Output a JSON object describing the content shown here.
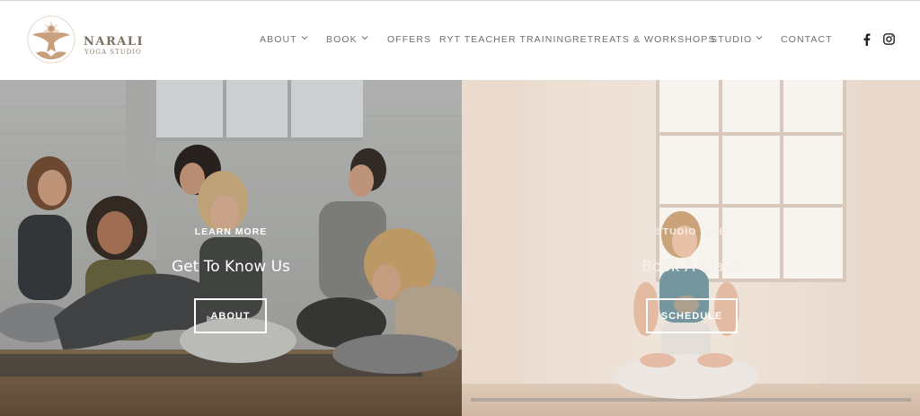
{
  "brand": {
    "name": "NARALI",
    "subtitle": "YOGA STUDIO",
    "logo_icon": "lotus-figure-icon",
    "accent": "#c9a98b"
  },
  "nav": {
    "items": [
      {
        "label": "ABOUT",
        "dropdown": true
      },
      {
        "label": "BOOK",
        "dropdown": true
      },
      {
        "label": "OFFERS",
        "dropdown": false
      },
      {
        "label": "RYT TEACHER TRAINING",
        "dropdown": false
      },
      {
        "label": "RETREATS & WORKSHOPS",
        "dropdown": false
      },
      {
        "label": "STUDIO",
        "dropdown": true
      },
      {
        "label": "CONTACT",
        "dropdown": false
      }
    ],
    "social": [
      {
        "name": "facebook-icon"
      },
      {
        "name": "instagram-icon"
      }
    ]
  },
  "hero": {
    "left": {
      "eyebrow": "LEARN MORE",
      "headline": "Get To Know Us",
      "button": "ABOUT",
      "image": "group of women laughing on yoga mats in bright studio"
    },
    "right": {
      "eyebrow": "STUDIO TIME",
      "headline": "Book A Class",
      "button": "SCHEDULE",
      "image": "woman seated cross-legged holding singing bowl by window"
    }
  }
}
